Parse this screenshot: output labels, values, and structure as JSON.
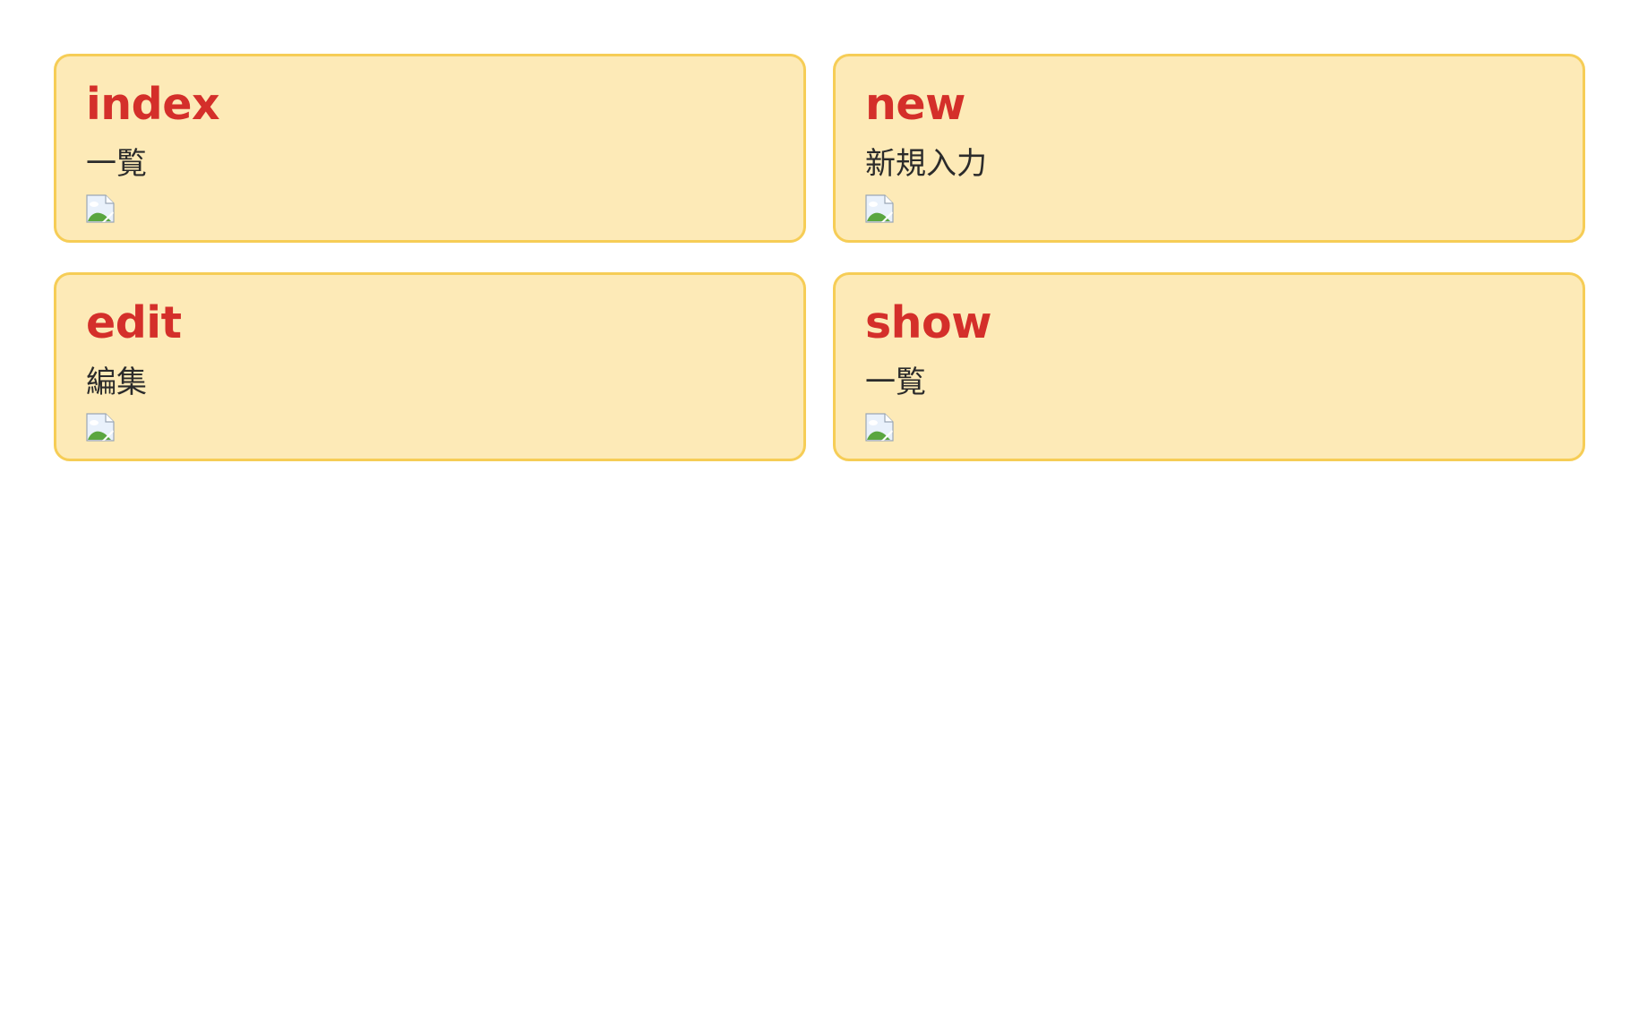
{
  "cards": [
    {
      "title": "index",
      "subtitle": "一覧",
      "icon": "broken-image-icon"
    },
    {
      "title": "new",
      "subtitle": "新規入力",
      "icon": "broken-image-icon"
    },
    {
      "title": "edit",
      "subtitle": "編集",
      "icon": "broken-image-icon"
    },
    {
      "title": "show",
      "subtitle": "一覧",
      "icon": "broken-image-icon"
    }
  ],
  "colors": {
    "card_background": "#fdeab7",
    "card_border": "#f6cd56",
    "title_color": "#d42f2a",
    "subtitle_color": "#2b2b2b"
  }
}
